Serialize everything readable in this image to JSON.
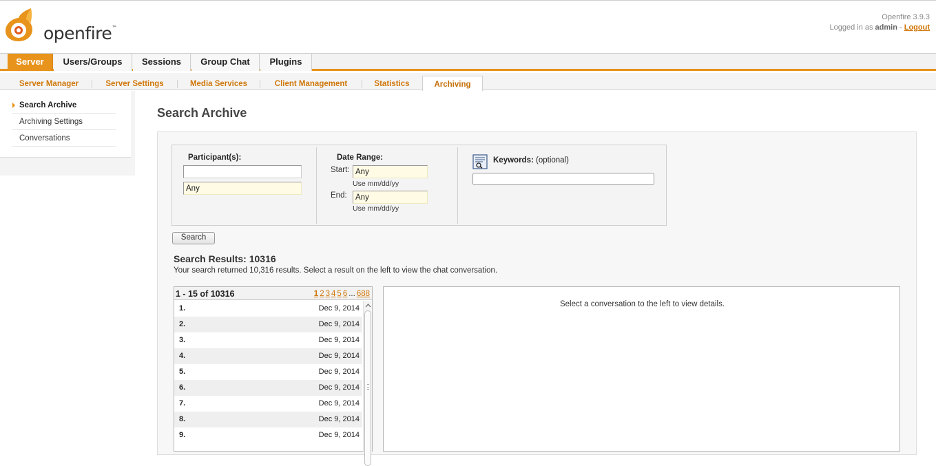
{
  "header": {
    "logo_text": "openfire",
    "logo_tm": "™",
    "version": "Openfire 3.9.3",
    "logged_in_prefix": "Logged in as",
    "user": "admin",
    "separator": " - ",
    "logout": "Logout"
  },
  "main_tabs": [
    {
      "label": "Server",
      "active": true
    },
    {
      "label": "Users/Groups"
    },
    {
      "label": "Sessions"
    },
    {
      "label": "Group Chat"
    },
    {
      "label": "Plugins"
    }
  ],
  "sub_tabs": [
    {
      "label": "Server Manager"
    },
    {
      "label": "Server Settings"
    },
    {
      "label": "Media Services"
    },
    {
      "label": "Client Management"
    },
    {
      "label": "Statistics"
    },
    {
      "label": "Archiving",
      "active": true
    }
  ],
  "sidebar": {
    "items": [
      {
        "label": "Search Archive",
        "active": true
      },
      {
        "label": "Archiving Settings"
      },
      {
        "label": "Conversations"
      }
    ]
  },
  "page_title": "Search Archive",
  "search": {
    "participants_label": "Participant(s):",
    "participant1_value": "",
    "participant2_value": "Any",
    "date_range_label": "Date Range:",
    "start_label": "Start:",
    "start_value": "Any",
    "end_label": "End:",
    "end_value": "Any",
    "date_hint": "Use mm/dd/yy",
    "keywords_label": "Keywords:",
    "keywords_optional": "(optional)",
    "keywords_value": "",
    "button_label": "Search"
  },
  "results": {
    "title": "Search Results: 10316",
    "description": "Your search returned 10,316 results. Select a result on the left to view the chat conversation.",
    "range": "1 - 15 of 10316",
    "pages": [
      "1",
      "2",
      "3",
      "4",
      "5",
      "6"
    ],
    "ellipsis": "...",
    "last_page": "688",
    "rows": [
      {
        "num": "1.",
        "date": "Dec 9, 2014"
      },
      {
        "num": "2.",
        "date": "Dec 9, 2014"
      },
      {
        "num": "3.",
        "date": "Dec 9, 2014"
      },
      {
        "num": "4.",
        "date": "Dec 9, 2014"
      },
      {
        "num": "5.",
        "date": "Dec 9, 2014"
      },
      {
        "num": "6.",
        "date": "Dec 9, 2014"
      },
      {
        "num": "7.",
        "date": "Dec 9, 2014"
      },
      {
        "num": "8.",
        "date": "Dec 9, 2014"
      },
      {
        "num": "9.",
        "date": "Dec 9, 2014"
      }
    ],
    "detail_message": "Select a conversation to the left to view details."
  },
  "colors": {
    "accent": "#e8931b",
    "link": "#d0780b"
  }
}
